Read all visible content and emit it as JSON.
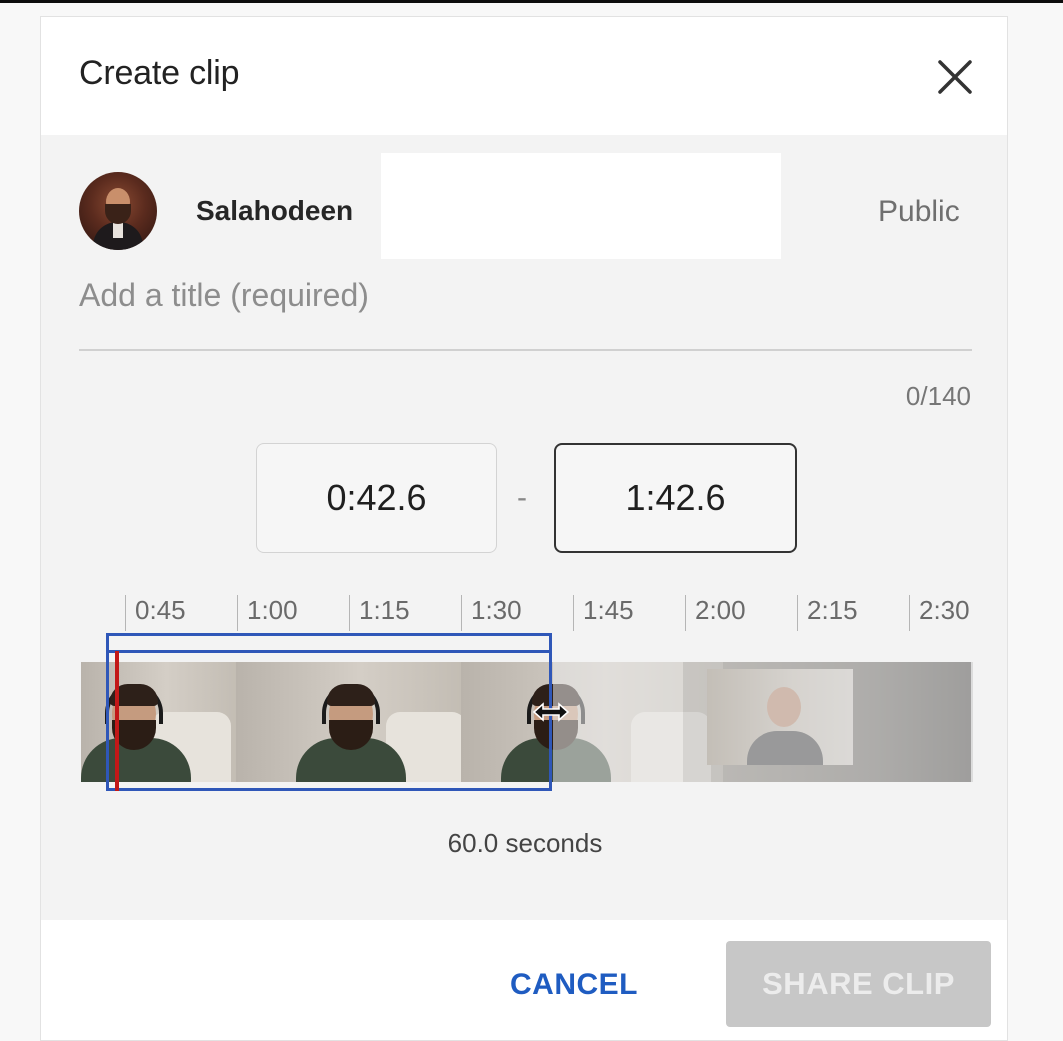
{
  "dialog": {
    "title": "Create clip",
    "close_icon": "close-icon"
  },
  "author": {
    "channel_name": "Salahodeen",
    "visibility": "Public"
  },
  "title_field": {
    "placeholder": "Add a title (required)",
    "value": "",
    "counter": "0/140"
  },
  "clip": {
    "start_time": "0:42.6",
    "separator": "-",
    "end_time": "1:42.6",
    "duration": "60.0 seconds"
  },
  "timeline": {
    "ticks": [
      "0:45",
      "1:00",
      "1:15",
      "1:30",
      "1:45",
      "2:00",
      "2:15",
      "2:30"
    ],
    "selection_color": "#2f57b8",
    "playhead_color": "#c21818"
  },
  "footer": {
    "cancel_label": "CANCEL",
    "share_label": "SHARE CLIP"
  },
  "colors": {
    "accent": "#1f5cc1",
    "disabled_button": "#c7c7c7"
  }
}
